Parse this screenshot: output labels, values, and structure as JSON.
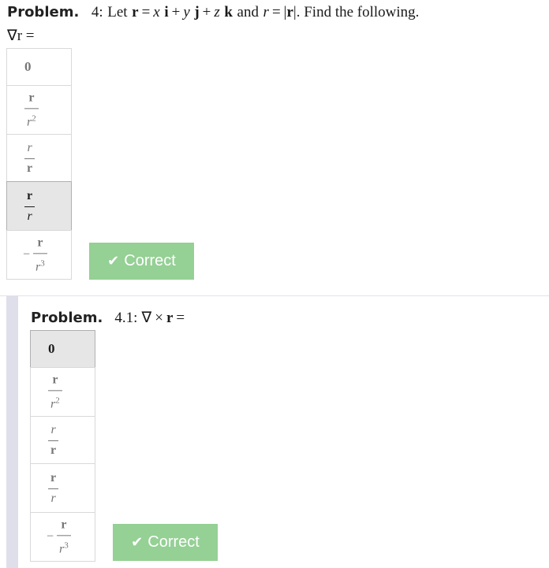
{
  "problem": {
    "label": "Problem.",
    "number": "4",
    "colon": ":",
    "statement_prefix": "Let",
    "r_bold": "r",
    "equals": "=",
    "x": "x",
    "i": "i",
    "plus": "+",
    "y": "y",
    "j": "j",
    "z": "z",
    "k": "k",
    "and": "and",
    "r_italic": "r",
    "abs_open": "|",
    "abs_close": "|",
    "statement_suffix": ". Find the following.",
    "question": "∇r =",
    "choices": [
      {
        "type": "zero",
        "text": "0"
      },
      {
        "type": "frac",
        "num": "r",
        "num_style": "bold",
        "den": "r",
        "den_style": "italic",
        "den_sup": "2"
      },
      {
        "type": "frac",
        "num": "r",
        "num_style": "italic",
        "den": "r",
        "den_style": "bold",
        "den_sup": ""
      },
      {
        "type": "frac",
        "num": "r",
        "num_style": "bold",
        "den": "r",
        "den_style": "italic",
        "den_sup": ""
      },
      {
        "type": "negfrac",
        "sign": "−",
        "num": "r",
        "num_style": "bold",
        "den": "r",
        "den_style": "italic",
        "den_sup": "3"
      }
    ],
    "selected_index": 3,
    "status_button": {
      "icon": "check-icon",
      "label": "Correct",
      "color": "#95d095"
    }
  },
  "subproblem": {
    "label": "Problem.",
    "number": "4.1",
    "colon": ":",
    "question": "∇ × r =",
    "nabla": "∇",
    "times": "×",
    "r_bold": "r",
    "equals": "=",
    "choices": [
      {
        "type": "zero",
        "text": "0"
      },
      {
        "type": "frac",
        "num": "r",
        "num_style": "bold",
        "den": "r",
        "den_style": "italic",
        "den_sup": "2"
      },
      {
        "type": "frac",
        "num": "r",
        "num_style": "italic",
        "den": "r",
        "den_style": "bold",
        "den_sup": ""
      },
      {
        "type": "frac",
        "num": "r",
        "num_style": "bold",
        "den": "r",
        "den_style": "italic",
        "den_sup": ""
      },
      {
        "type": "negfrac",
        "sign": "−",
        "num": "r",
        "num_style": "bold",
        "den": "r",
        "den_style": "italic",
        "den_sup": "3"
      }
    ],
    "selected_index": 0,
    "status_button": {
      "icon": "check-icon",
      "label": "Correct",
      "color": "#95d095"
    }
  }
}
